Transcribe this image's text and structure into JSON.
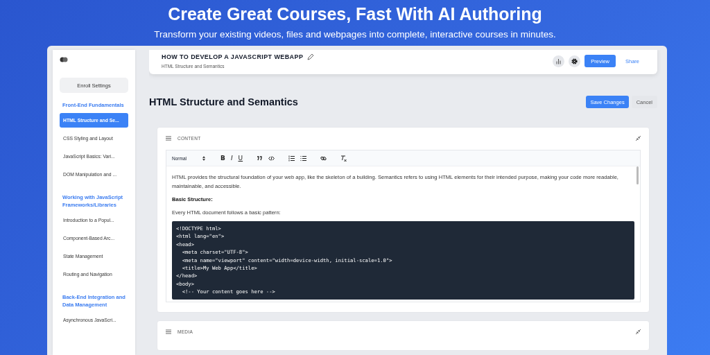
{
  "banner": {
    "title": "Create Great Courses, Fast With AI Authoring",
    "subtitle": "Transform your existing videos, files and webpages into complete, interactive courses in minutes."
  },
  "sidebar": {
    "button": "Enroll Settings",
    "sections": [
      {
        "title": "Front-End Fundamentals",
        "lessons": [
          {
            "label": "HTML Structure and Se...",
            "selected": true
          },
          {
            "label": "CSS Styling and Layout",
            "selected": false
          },
          {
            "label": "JavaScript Basics: Vari...",
            "selected": false
          },
          {
            "label": "DOM Manipulation and ...",
            "selected": false
          }
        ]
      },
      {
        "title": "Working with JavaScript Frameworks/Libraries",
        "lessons": [
          {
            "label": "Introduction to a Popul...",
            "selected": false
          },
          {
            "label": "Component-Based Arc...",
            "selected": false
          },
          {
            "label": "State Management",
            "selected": false
          },
          {
            "label": "Routing and Navigation",
            "selected": false
          }
        ]
      },
      {
        "title": "Back-End Integration and Data Management",
        "lessons": [
          {
            "label": "Asynchronous JavaScri...",
            "selected": false
          }
        ]
      }
    ]
  },
  "header": {
    "course_title": "HOW TO DEVELOP A JAVASCRIPT WEBAPP",
    "subtitle": "HTML Structure and Semantics",
    "preview": "Preview",
    "share": "Share"
  },
  "page": {
    "title": "HTML Structure and Semantics",
    "save": "Save Changes",
    "cancel": "Cancel"
  },
  "content_panel": {
    "label": "CONTENT",
    "toolbar": {
      "format": "Normal",
      "marks": [
        {
          "kind": "bold",
          "label": "B"
        },
        {
          "kind": "italic",
          "label": "I"
        },
        {
          "kind": "underline",
          "label": "U"
        }
      ]
    },
    "blocks": [
      {
        "kind": "text",
        "text": "HTML provides the structural foundation of your web app, like the skeleton of a building.  Semantics refers to using HTML elements for their intended purpose, making your code more readable, maintainable, and accessible."
      },
      {
        "kind": "heading",
        "text": "Basic Structure:"
      },
      {
        "kind": "text",
        "text": "Every HTML document follows a basic pattern:"
      },
      {
        "kind": "code",
        "lines": [
          "<!DOCTYPE html>",
          "<html lang=\"en\">",
          "<head>",
          "  <meta charset=\"UTF-8\">",
          "  <meta name=\"viewport\" content=\"width=device-width, initial-scale=1.0\">",
          "  <title>My Web App</title>",
          "</head>",
          "<body>",
          "  <!-- Your content goes here -->"
        ]
      }
    ]
  },
  "media_panel": {
    "label": "MEDIA"
  }
}
